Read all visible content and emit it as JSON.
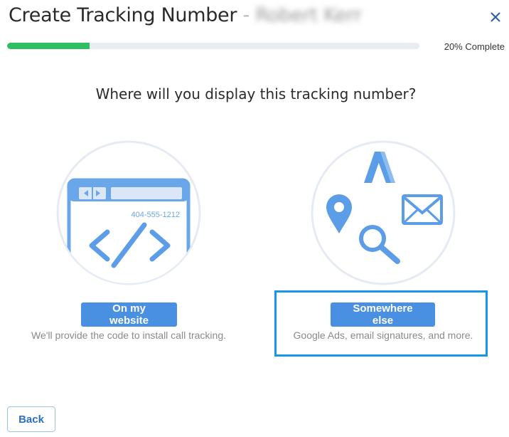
{
  "header": {
    "title": "Create Tracking Number",
    "separator": "-",
    "account_name": "Robert Kerr"
  },
  "progress": {
    "fraction": 0.2,
    "label": "20% Complete",
    "color": "#2fbf63"
  },
  "question": "Where will you display this tracking number?",
  "options": [
    {
      "button_label": "On my website",
      "description": "We'll provide the code to install call tracking.",
      "illustration_phone": "404-555-1212",
      "icon": "browser-code-icon",
      "selected": false
    },
    {
      "button_label": "Somewhere else",
      "description": "Google Ads, email signatures, and more.",
      "icons": [
        "google-ads-icon",
        "location-pin-icon",
        "envelope-icon",
        "magnifier-icon"
      ],
      "selected": true
    }
  ],
  "footer": {
    "back_label": "Back"
  },
  "colors": {
    "accent": "#4a90e2",
    "selection": "#1a96e8",
    "illustration": "#5b9de6"
  }
}
